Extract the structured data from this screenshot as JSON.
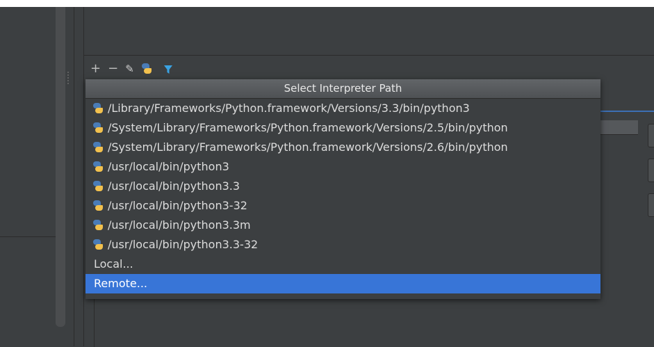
{
  "toolbar": {
    "add": "+",
    "remove": "−",
    "edit": "✎",
    "filter": "⏷",
    "icons": [
      "add-icon",
      "remove-icon",
      "pencil-icon",
      "python-icon",
      "filter-icon"
    ],
    "filter_color": "#3aa3e3"
  },
  "popup": {
    "title": "Select Interpreter Path",
    "interpreters": [
      "/Library/Frameworks/Python.framework/Versions/3.3/bin/python3",
      "/System/Library/Frameworks/Python.framework/Versions/2.5/bin/python",
      "/System/Library/Frameworks/Python.framework/Versions/2.6/bin/python",
      "/usr/local/bin/python3",
      "/usr/local/bin/python3.3",
      "/usr/local/bin/python3-32",
      "/usr/local/bin/python3.3m",
      "/usr/local/bin/python3.3-32"
    ],
    "local": "Local...",
    "remote": "Remote..."
  },
  "colors": {
    "selection": "#3875d7",
    "background": "#3c3f41"
  }
}
